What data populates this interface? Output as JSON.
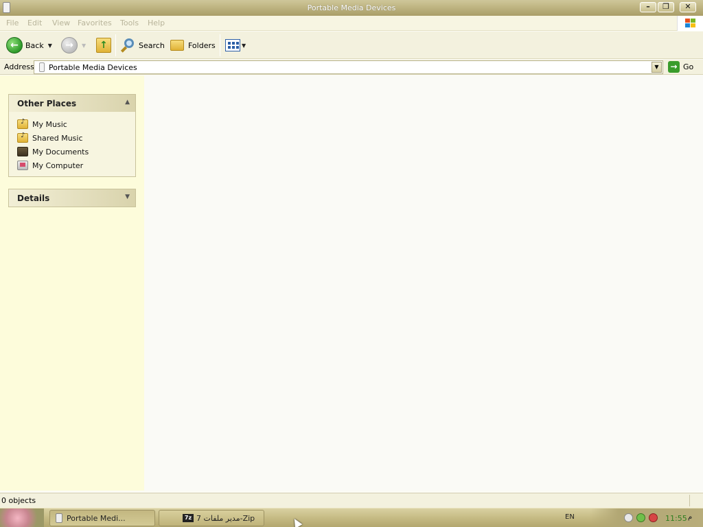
{
  "window": {
    "title": "Portable Media Devices"
  },
  "menu": [
    "File",
    "Edit",
    "View",
    "Favorites",
    "Tools",
    "Help"
  ],
  "toolbar": {
    "back": "Back",
    "search": "Search",
    "folders": "Folders"
  },
  "address": {
    "label": "Address",
    "value": "Portable Media Devices",
    "go": "Go"
  },
  "other_places": {
    "title": "Other Places",
    "items": [
      {
        "label": "My Music",
        "icon": "music-folder-icon"
      },
      {
        "label": "Shared Music",
        "icon": "music-folder-icon"
      },
      {
        "label": "My Documents",
        "icon": "documents-folder-icon"
      },
      {
        "label": "My Computer",
        "icon": "computer-icon"
      }
    ]
  },
  "details": {
    "title": "Details"
  },
  "status": {
    "text": "0 objects"
  },
  "taskbar": {
    "tasks": [
      {
        "label": "Portable Medi..."
      },
      {
        "label": "مدير ملفات 7-Zip",
        "icon_text": "7z"
      }
    ],
    "lang": "EN",
    "clock": "11:55",
    "ampm": "م"
  },
  "colors": {
    "titlebar": "#bfb582",
    "taskpane": "#fdfcdb",
    "go_green": "#3a9c2c",
    "clock_green": "#2d7d1f"
  }
}
